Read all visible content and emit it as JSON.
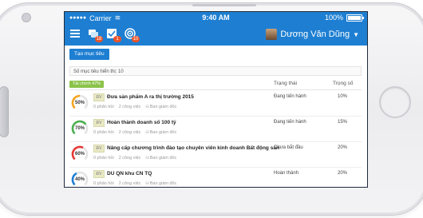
{
  "status_bar": {
    "carrier": "Carrier",
    "time": "9:40 AM",
    "battery": "100%"
  },
  "nav": {
    "badges": [
      "18",
      "1",
      "10"
    ],
    "user_name": "Dương Văn Dũng"
  },
  "toolbar": {
    "create_goal_label": "Tạo mục tiêu"
  },
  "list": {
    "count_label": "Số mục tiêu hiển thị: 10",
    "group_label": "Tài chính 47%",
    "col_status": "Trạng thái",
    "col_weight": "Trọng số",
    "rows": [
      {
        "percent": "50%",
        "tag": "ĐV",
        "title": "Đưa sản phẩm A ra thị trường 2015",
        "feedback": "0 phản hồi",
        "tasks": "2 công việc",
        "owner": "Ban giám đốc",
        "status": "Đang tiến hành",
        "weight": "10%",
        "value": 50,
        "color": "#f5a623"
      },
      {
        "percent": "70%",
        "tag": "ĐV",
        "title": "Hoàn thành doanh số 100 tỷ",
        "feedback": "0 phản hồi",
        "tasks": "2 công việc",
        "owner": "Ban giám đốc",
        "status": "Đang tiến hành",
        "weight": "15%",
        "value": 70,
        "color": "#4caf50"
      },
      {
        "percent": "60%",
        "tag": "ĐV",
        "title": "Nâng cấp chương trình đào tạo chuyên viên kinh doanh Bất động sản",
        "feedback": "0 phản hồi",
        "tasks": "2 công việc",
        "owner": "Ban giám đốc",
        "status": "Chưa bắt đầu",
        "weight": "20%",
        "value": 60,
        "color": "#e53935"
      },
      {
        "percent": "40%",
        "tag": "ĐV",
        "title": "DU QN khu CN TQ",
        "feedback": "0 phản hồi",
        "tasks": "2 công việc",
        "owner": "Ban giám đốc",
        "status": "Hoàn thành",
        "weight": "20%",
        "value": 40,
        "color": "#1e7fd2"
      }
    ]
  }
}
